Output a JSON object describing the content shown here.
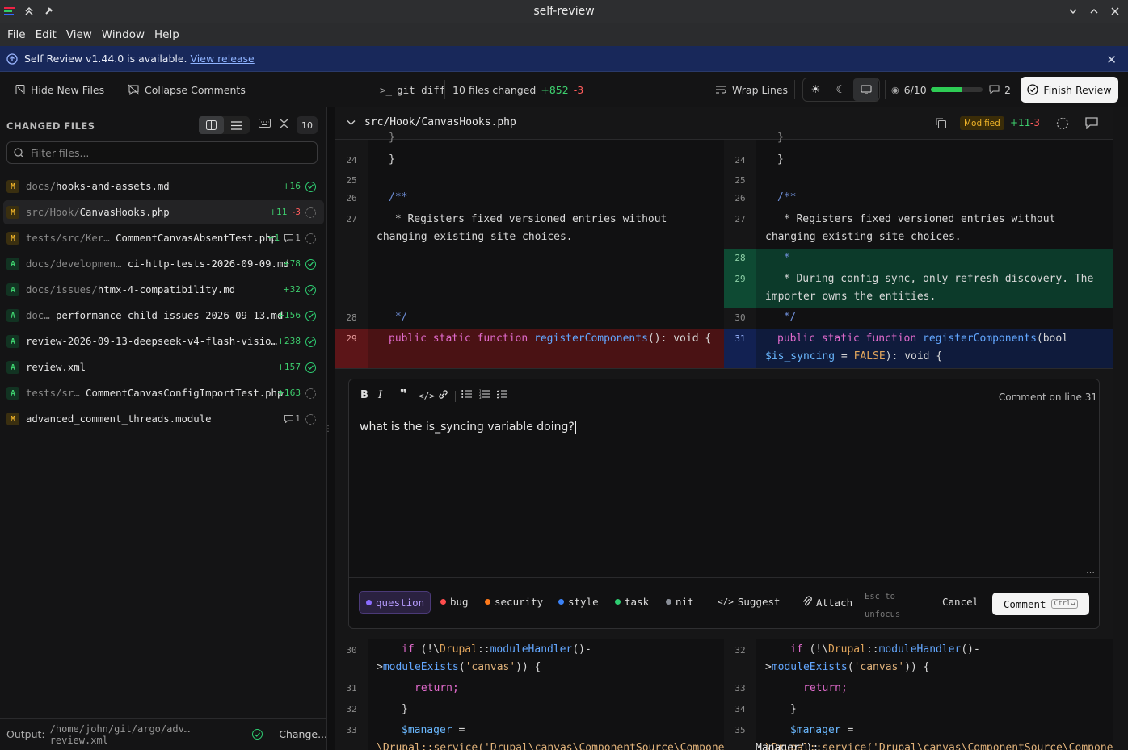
{
  "window": {
    "title": "self-review"
  },
  "menu": [
    "File",
    "Edit",
    "View",
    "Window",
    "Help"
  ],
  "banner": {
    "text": "Self Review v1.44.0 is available.",
    "link": "View release"
  },
  "toolbar": {
    "hide_new_files": "Hide New Files",
    "collapse_comments": "Collapse Comments",
    "git_diff": "git diff",
    "files_changed": "10 files changed",
    "additions": "+852",
    "deletions": "-3",
    "wrap_lines": "Wrap Lines",
    "reviewed": "6/10",
    "reviewed_fraction": 0.6,
    "comments": "2",
    "finish": "Finish Review"
  },
  "sidebar": {
    "header": "CHANGED FILES",
    "count": "10",
    "filter_placeholder": "Filter files...",
    "files": [
      {
        "status": "M",
        "dir": "docs/",
        "name": "hooks-and-assets.md",
        "add": "+16",
        "del": "",
        "comments": "",
        "reviewed": true
      },
      {
        "status": "M",
        "dir": "src/Hook/",
        "name": "CanvasHooks.php",
        "add": "+11",
        "del": "-3",
        "comments": "",
        "reviewed": false
      },
      {
        "status": "M",
        "dir": "tests/src/Ker…",
        "name": "CommentCanvasAbsentTest.php",
        "add": "+1",
        "del": "",
        "comments": "1",
        "reviewed": false
      },
      {
        "status": "A",
        "dir": "docs/developmen…",
        "name": "ci-http-tests-2026-09-09.md",
        "add": "+78",
        "del": "",
        "comments": "",
        "reviewed": true
      },
      {
        "status": "A",
        "dir": "docs/issues/",
        "name": "htmx-4-compatibility.md",
        "add": "+32",
        "del": "",
        "comments": "",
        "reviewed": true
      },
      {
        "status": "A",
        "dir": "doc…",
        "name": "performance-child-issues-2026-09-13.md",
        "add": "+156",
        "del": "",
        "comments": "",
        "reviewed": true
      },
      {
        "status": "A",
        "dir": "",
        "name": "review-2026-09-13-deepseek-v4-flash-visio…",
        "add": "+238",
        "del": "",
        "comments": "",
        "reviewed": true
      },
      {
        "status": "A",
        "dir": "",
        "name": "review.xml",
        "add": "+157",
        "del": "",
        "comments": "",
        "reviewed": true
      },
      {
        "status": "A",
        "dir": "tests/sr…",
        "name": "CommentCanvasConfigImportTest.php",
        "add": "+163",
        "del": "",
        "comments": "",
        "reviewed": false
      },
      {
        "status": "M",
        "dir": "",
        "name": "advanced_comment_threads.module",
        "add": "",
        "del": "",
        "comments": "1",
        "reviewed": false
      }
    ],
    "footer_label": "Output:",
    "footer_path": "/home/john/git/argo/adv…review.xml",
    "footer_change": "Change..."
  },
  "file": {
    "path": "src/Hook/CanvasHooks.php",
    "status": "Modified",
    "add": "+11",
    "del": "-3"
  },
  "diff": {
    "left_numbers": [
      "24",
      "25",
      "26",
      "27",
      "28",
      "29"
    ],
    "right_numbers": [
      "24",
      "25",
      "26",
      "27",
      "28",
      "29",
      "30",
      "31"
    ],
    "lines": {
      "l24": "}",
      "l26": "/**",
      "l27a": " * Registers fixed versioned entries without",
      "l27b": "changing existing site choices.",
      "r28": " *",
      "r29a": " * During config sync, only refresh discovery. The",
      "r29b": "importer owns the entities.",
      "l28": " */",
      "l29_kw": "public static function",
      "l29_fn": "registerComponents",
      "l29_rest": "(): void {",
      "r31_kw": "public static function",
      "r31_fn": "registerComponents",
      "r31_a": "(bool",
      "r31_var": "$is_syncing",
      "r31_eq": " = ",
      "r31_lit": "FALSE",
      "r31_end": "): void {"
    },
    "after": {
      "left_numbers": [
        "30",
        "31",
        "32",
        "33"
      ],
      "right_numbers": [
        "32",
        "33",
        "34",
        "35"
      ],
      "if_a": "if (!\\",
      "if_cls": "Drupal",
      "if_b": "::",
      "if_fn": "moduleHandler",
      "if_c": "()-",
      "if2_a": ">",
      "if2_fn": "moduleExists",
      "if2_b": "(",
      "if2_str": "'canvas'",
      "if2_c": ")) {",
      "return": "return;",
      "close": "}",
      "manager": "$manager",
      "manager_eq": " =",
      "svc_a": "\\Drupal::service('Drupal\\canvas\\ComponentSource\\ComponentSou…",
      "svc_b": "\\Drupal::service('Drupal\\canvas\\ComponentSource\\Compone…",
      "overlay": "Manager');"
    }
  },
  "comment": {
    "line_label": "Comment on line 31",
    "text": "what is the is_syncing variable doing?",
    "labels": [
      {
        "name": "question",
        "color": "#8b6cff"
      },
      {
        "name": "bug",
        "color": "#ff4d4d"
      },
      {
        "name": "security",
        "color": "#ff7a1a"
      },
      {
        "name": "style",
        "color": "#3b82f6"
      },
      {
        "name": "task",
        "color": "#2ecc71"
      },
      {
        "name": "nit",
        "color": "#8a8f98"
      }
    ],
    "suggest": "Suggest",
    "attach": "Attach",
    "esc_hint_a": "Esc to",
    "esc_hint_b": "unfocus",
    "cancel": "Cancel",
    "submit": "Comment",
    "kbd": "Ctrl↵"
  }
}
